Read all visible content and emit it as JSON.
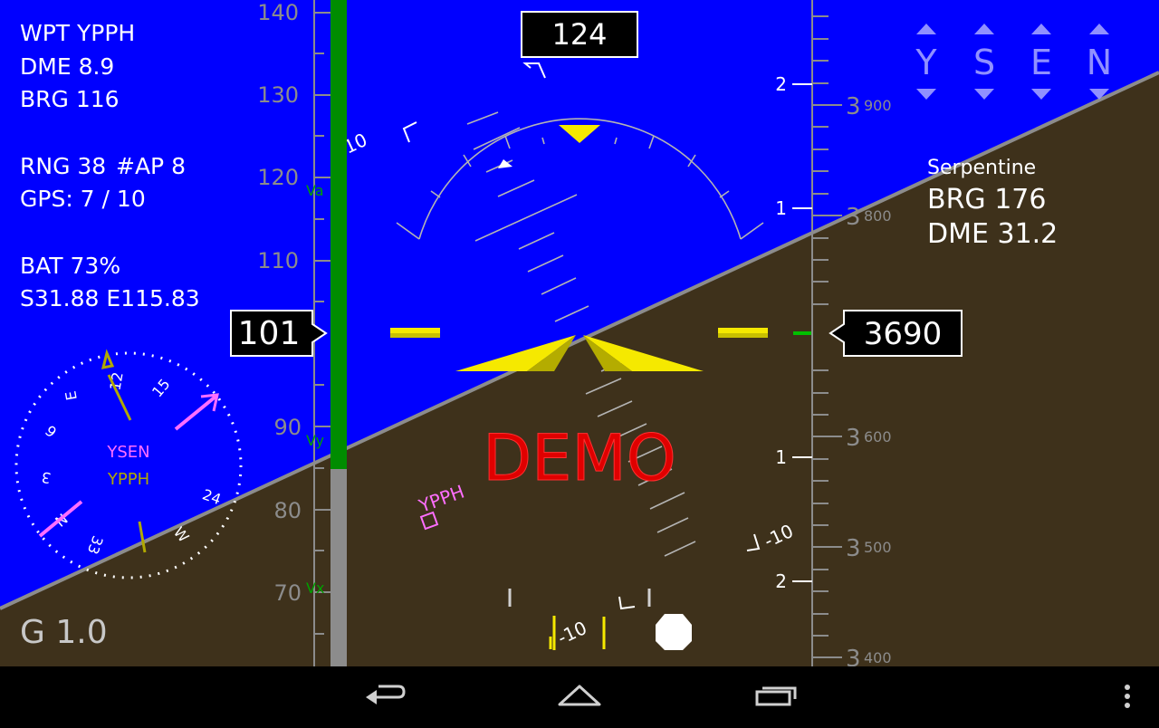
{
  "waypoint": {
    "wpt": "WPT YPPH",
    "dme": "DME 8.9",
    "brg": "BRG  116"
  },
  "status": {
    "rng": "RNG 38",
    "ap": "#AP 8",
    "gps": "GPS: 7 / 10"
  },
  "battery": {
    "bat": "BAT  73%",
    "position": "S31.88 E115.83"
  },
  "gload": "G 1.0",
  "demo_label": "DEMO",
  "heading_readout": "124",
  "airspeed": {
    "readout": "101",
    "ticks": [
      "140",
      "130",
      "120",
      "110",
      "90",
      "80",
      "70"
    ],
    "markers": [
      "Va",
      "Vy",
      "Vx"
    ]
  },
  "altitude": {
    "readout": "3690",
    "ticks": [
      {
        "big": "3",
        "small": "900"
      },
      {
        "big": "3",
        "small": "800"
      },
      {
        "big": "3",
        "small": "600"
      },
      {
        "big": "3",
        "small": "500"
      },
      {
        "big": "3",
        "small": "400"
      }
    ]
  },
  "vsi_labels": [
    "2",
    "1",
    "1",
    "2"
  ],
  "pitch_labels": [
    "10",
    "-10",
    "-10"
  ],
  "airports": [
    "Y",
    "S",
    "E",
    "N"
  ],
  "secondary_wpt": {
    "name": "Serpentine",
    "brg": "BRG  176",
    "dme": "DME 31.2"
  },
  "compass": {
    "labels": [
      "12",
      "15",
      "E",
      "6",
      "3",
      "N",
      "33",
      "W",
      "24"
    ],
    "wpt1": "YSEN",
    "wpt2": "YPPH"
  },
  "terrain_wpt": "YPPH",
  "colors": {
    "sky": "#0000ff",
    "ground": "#3e311b",
    "accent": "#f5e900",
    "pink": "#ff6eff",
    "demo": "#e00000"
  }
}
